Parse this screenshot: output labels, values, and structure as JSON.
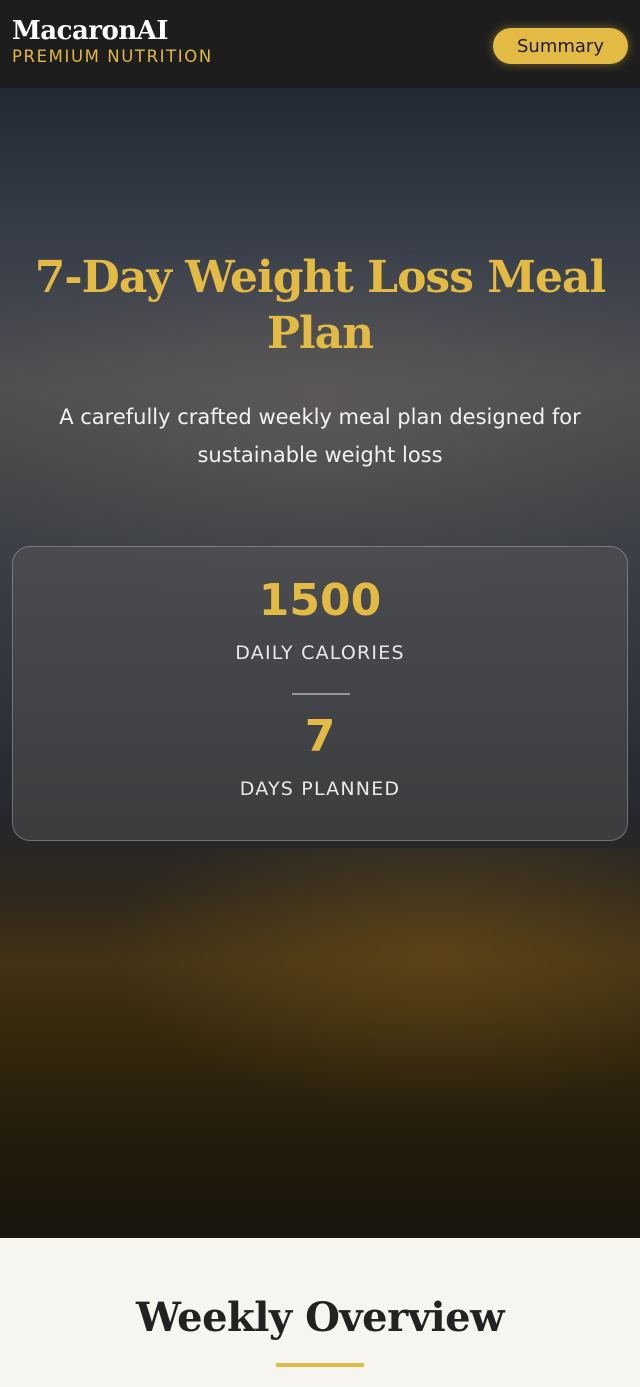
{
  "header": {
    "brand_name": "MacaronAI",
    "brand_tagline": "PREMIUM NUTRITION",
    "summary_label": "Summary"
  },
  "hero": {
    "title": "7-Day Weight Loss Meal Plan",
    "subtitle": "A carefully crafted weekly meal plan designed for sustainable weight loss",
    "stats": [
      {
        "value": "1500",
        "label": "DAILY CALORIES"
      },
      {
        "value": "7",
        "label": "DAYS PLANNED"
      }
    ]
  },
  "overview": {
    "title": "Weekly Overview"
  },
  "colors": {
    "accent_gold": "#e3bb44",
    "header_bg": "#1d1d1d",
    "page_bg": "#f6f5f0"
  }
}
